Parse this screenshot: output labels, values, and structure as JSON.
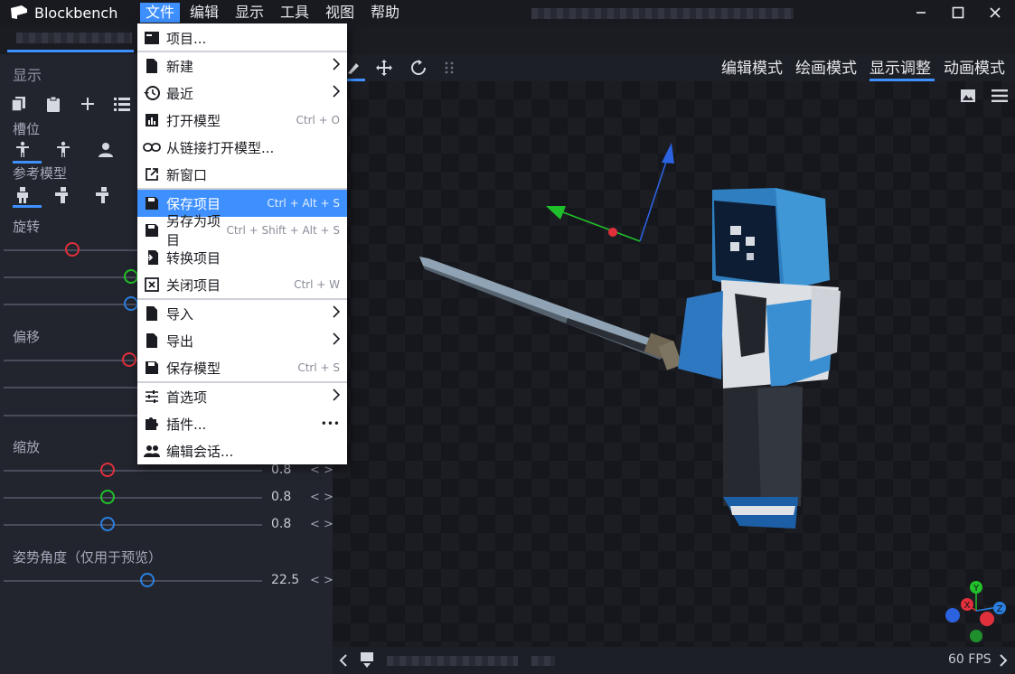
{
  "app": {
    "title": "Blockbench"
  },
  "menubar": [
    {
      "label": "文件",
      "active": true
    },
    {
      "label": "编辑"
    },
    {
      "label": "显示"
    },
    {
      "label": "工具"
    },
    {
      "label": "视图"
    },
    {
      "label": "帮助"
    }
  ],
  "file_menu": {
    "items": [
      {
        "label": "项目...",
        "icon": "project-icon",
        "shortcut": "",
        "submenu": false
      },
      {
        "label": "新建",
        "icon": "file-icon",
        "shortcut": "",
        "submenu": true
      },
      {
        "label": "最近",
        "icon": "history-icon",
        "shortcut": "",
        "submenu": true
      },
      {
        "label": "打开模型",
        "icon": "chart-icon",
        "shortcut": "Ctrl + O",
        "submenu": false
      },
      {
        "label": "从链接打开模型...",
        "icon": "link-icon",
        "shortcut": "",
        "submenu": false
      },
      {
        "label": "新窗口",
        "icon": "open-in-new-icon",
        "shortcut": "",
        "submenu": false
      },
      {
        "label": "保存项目",
        "icon": "save-icon",
        "shortcut": "Ctrl + Alt + S",
        "submenu": false,
        "highlighted": true
      },
      {
        "label": "另存为项目",
        "icon": "save-icon",
        "shortcut": "Ctrl + Shift + Alt + S",
        "submenu": false
      },
      {
        "label": "转换项目",
        "icon": "convert-icon",
        "shortcut": "",
        "submenu": false
      },
      {
        "label": "关闭项目",
        "icon": "close-box-icon",
        "shortcut": "Ctrl + W",
        "submenu": false
      },
      {
        "label": "导入",
        "icon": "file-icon",
        "shortcut": "",
        "submenu": true
      },
      {
        "label": "导出",
        "icon": "file-icon",
        "shortcut": "",
        "submenu": true
      },
      {
        "label": "保存模型",
        "icon": "save-icon",
        "shortcut": "Ctrl + S",
        "submenu": false
      },
      {
        "label": "首选项",
        "icon": "tune-icon",
        "shortcut": "",
        "submenu": true
      },
      {
        "label": "插件...",
        "icon": "puzzle-icon",
        "shortcut": "•••",
        "submenu": false
      },
      {
        "label": "编辑会话...",
        "icon": "people-icon",
        "shortcut": "",
        "submenu": false
      }
    ]
  },
  "left_panel": {
    "title": "显示",
    "slot_label": "槽位",
    "reference_label": "参考模型",
    "rotation_label": "旋转",
    "offset_label": "偏移",
    "scale_label": "缩放",
    "scale_values": [
      "0.8",
      "0.8",
      "0.8"
    ],
    "pose_label": "姿势角度（仅用于预览）",
    "pose_value": "22.5"
  },
  "modes": [
    "编辑模式",
    "绘画模式",
    "显示调整",
    "动画模式"
  ],
  "active_mode": "显示调整",
  "status": {
    "fps": "60 FPS"
  },
  "gizmo_axes": [
    "Y",
    "X",
    "Z"
  ],
  "colors": {
    "accent": "#3e90ff",
    "x_axis": "#e0303c",
    "y_axis": "#22c02b",
    "z_axis": "#2b7fe0"
  }
}
